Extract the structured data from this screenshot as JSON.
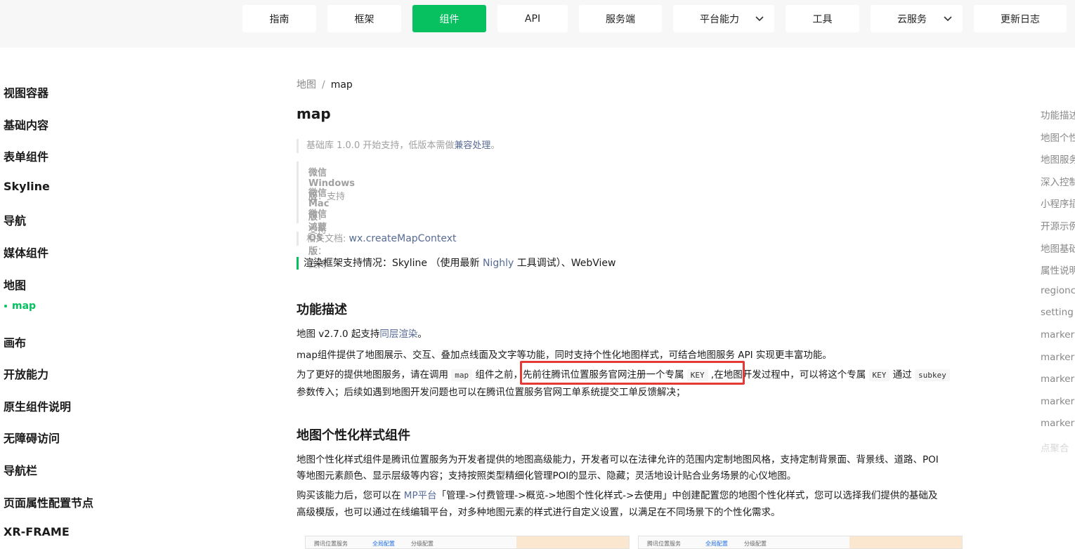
{
  "topnav": {
    "items": [
      {
        "label": "指南",
        "active": false,
        "dropdown": false
      },
      {
        "label": "框架",
        "active": false,
        "dropdown": false
      },
      {
        "label": "组件",
        "active": true,
        "dropdown": false
      },
      {
        "label": "API",
        "active": false,
        "dropdown": false
      },
      {
        "label": "服务端",
        "active": false,
        "dropdown": false
      },
      {
        "label": "平台能力",
        "active": false,
        "dropdown": true
      },
      {
        "label": "工具",
        "active": false,
        "dropdown": false
      },
      {
        "label": "云服务",
        "active": false,
        "dropdown": true
      },
      {
        "label": "更新日志",
        "active": false,
        "dropdown": false
      }
    ]
  },
  "sidebar": {
    "items": [
      {
        "label": "视图容器"
      },
      {
        "label": "基础内容"
      },
      {
        "label": "表单组件"
      },
      {
        "label": "Skyline"
      },
      {
        "label": "导航"
      },
      {
        "label": "媒体组件"
      },
      {
        "label": "地图"
      },
      {
        "label": "画布"
      },
      {
        "label": "开放能力"
      },
      {
        "label": "原生组件说明"
      },
      {
        "label": "无障碍访问"
      },
      {
        "label": "导航栏"
      },
      {
        "label": "页面属性配置节点"
      },
      {
        "label": "XR-FRAME"
      }
    ],
    "active_sub": "map"
  },
  "breadcrumb": {
    "parent": "地图",
    "separator": "/",
    "current": "map"
  },
  "page_title": "map",
  "notes": {
    "base_lib_prefix": "基础库 1.0.0 开始支持，低版本需做",
    "base_lib_link": "兼容处理",
    "base_lib_suffix": "。",
    "platforms": [
      {
        "name": "微信 Windows 版",
        "value": "：支持"
      },
      {
        "name": "微信 Mac 版",
        "value": "：支持"
      },
      {
        "name": "微信 鸿蒙 OS 版",
        "value": "：支持"
      }
    ],
    "related_label": "相关文档: ",
    "related_link": "wx.createMapContext"
  },
  "render_support": {
    "prefix": "渲染框架支持情况：Skyline （使用最新 ",
    "link": "Nighly",
    "suffix": " 工具调试）、WebView"
  },
  "section1": {
    "heading": "功能描述",
    "p1_prefix": "地图 v2.7.0 起支持",
    "p1_link": "同层渲染",
    "p1_suffix": "。",
    "p2": "map组件提供了地图展示、交互、叠加点线面及文字等功能，同时支持个性化地图样式，可结合地图服务 API 实现更丰富功能。",
    "p3_a": "为了更好的提供地图服务，请在调用 ",
    "p3_code1": "map",
    "p3_b": " 组件之前，先前往腾讯位置服务官网注册一个专属 ",
    "p3_code2": "KEY",
    "p3_c": " ,在地图开发过程中，可以将这个专属 ",
    "p3_code3": "KEY",
    "p3_d": " 通过 ",
    "p3_code4": "subkey",
    "p3_line2": "参数传入；后续如遇到地图开发问题也可以在腾讯位置服务官网工单系统提交工单反馈解决；"
  },
  "section2": {
    "heading": "地图个性化样式组件",
    "p1_line1": "地图个性化样式组件是腾讯位置服务为开发者提供的地图高级能力，开发者可以在法律允许的范围内定制地图风格，支持定制背景面、背景线、道路、POI",
    "p1_line2": "等地图元素颜色、显示层级等内容；支持按照类型精细化管理POI的显示、隐藏；灵活地设计贴合业务场景的心仪地图。",
    "p2_a": "购买该能力后，您可以在 ",
    "p2_link": "MP平台",
    "p2_b": "「管理->付费管理->概览->地图个性化样式->去使用」中创建配置您的地图个性化样式，您可以选择我们提供的基础及",
    "p2_line2": "高级模版，也可以通过在线编辑平台，对多种地图元素的样式进行自定义设置，以满足在不同场景下的个性化需求。"
  },
  "thumbnails": [
    {
      "t1": "腾讯位置服务",
      "t2": "全局配置",
      "t3": "分级配置"
    },
    {
      "t1": "腾讯位置服务",
      "t2": "全局配置",
      "t3": "分级配置"
    }
  ],
  "toc": {
    "items": [
      {
        "label": "功能描述"
      },
      {
        "label": "地图个性"
      },
      {
        "label": "地图服务"
      },
      {
        "label": "深入控制"
      },
      {
        "label": "小程序插"
      },
      {
        "label": "开源示例"
      },
      {
        "label": "地图基础"
      },
      {
        "label": "属性说明"
      },
      {
        "label": "regionc"
      },
      {
        "label": "setting"
      },
      {
        "label": "marker"
      },
      {
        "label": "marker"
      },
      {
        "label": "marker"
      },
      {
        "label": "marker"
      },
      {
        "label": "marker"
      },
      {
        "label": "点聚合"
      }
    ]
  },
  "colors": {
    "accent": "#07c160",
    "link": "#576b95",
    "highlight": "#e53935"
  }
}
